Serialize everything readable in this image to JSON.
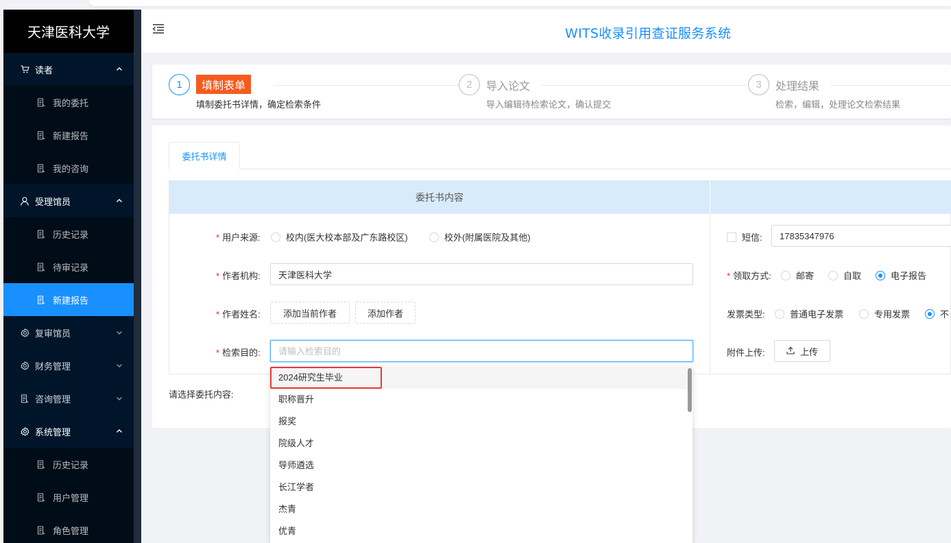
{
  "sidebar": {
    "brand": "天津医科大学",
    "groups": [
      {
        "label": "读者",
        "icon": "cart-icon",
        "expanded": true,
        "items": [
          "我的委托",
          "新建报告",
          "我的咨询"
        ]
      },
      {
        "label": "受理馆员",
        "icon": "user-icon",
        "expanded": true,
        "items": [
          "历史记录",
          "待审记录",
          "新建报告"
        ]
      },
      {
        "label": "复审馆员",
        "icon": "gear-icon",
        "expanded": false,
        "items": []
      },
      {
        "label": "财务管理",
        "icon": "gear-icon",
        "expanded": false,
        "items": []
      },
      {
        "label": "咨询管理",
        "icon": "doc-icon",
        "expanded": false,
        "items": []
      },
      {
        "label": "系统管理",
        "icon": "gear-icon",
        "expanded": true,
        "items": [
          "历史记录",
          "用户管理",
          "角色管理"
        ]
      }
    ],
    "active_item": "受理馆员/新建报告"
  },
  "header": {
    "title": "WITS收录引用查证服务系统"
  },
  "steps": [
    {
      "num": "1",
      "title": "填制表单",
      "desc": "填制委托书详情，确定检索条件",
      "active": true
    },
    {
      "num": "2",
      "title": "导入论文",
      "desc": "导入编辑待检索论文，确认提交",
      "active": false
    },
    {
      "num": "3",
      "title": "处理结果",
      "desc": "检索，编辑，处理论文检索结果",
      "active": false
    }
  ],
  "tab": {
    "label": "委托书详情"
  },
  "form": {
    "section_header": "委托书内容",
    "user_source": {
      "label": "用户来源:",
      "options": [
        "校内(医大校本部及广东路校区)",
        "校外(附属医院及其他)"
      ],
      "selected": null
    },
    "author_org": {
      "label": "作者机构:",
      "value": "天津医科大学"
    },
    "author_name": {
      "label": "作者姓名:",
      "add_current": "添加当前作者",
      "add": "添加作者"
    },
    "purpose": {
      "label": "检索目的:",
      "placeholder": "请输入检索目的"
    },
    "sms": {
      "label": "短信:",
      "checked": false,
      "value": "17835347976"
    },
    "pickup": {
      "label": "领取方式:",
      "options": [
        "邮寄",
        "自取",
        "电子报告"
      ],
      "selected": "电子报告"
    },
    "invoice": {
      "label": "发票类型:",
      "options": [
        "普通电子发票",
        "专用发票",
        "不"
      ],
      "selected": "不"
    },
    "attachment": {
      "label": "附件上传:",
      "button": "上传"
    },
    "choose_content_label": "请选择委托内容:"
  },
  "dropdown": {
    "options": [
      "2024研究生毕业",
      "职称晋升",
      "报奖",
      "院级人才",
      "导师遴选",
      "长江学者",
      "杰青",
      "优青"
    ],
    "hovered": "2024研究生毕业",
    "highlight_color": "#e53935"
  },
  "colors": {
    "primary": "#1890ff",
    "sidebar": "#001529",
    "step_active": "#f55a1e",
    "required": "#f5222d"
  }
}
